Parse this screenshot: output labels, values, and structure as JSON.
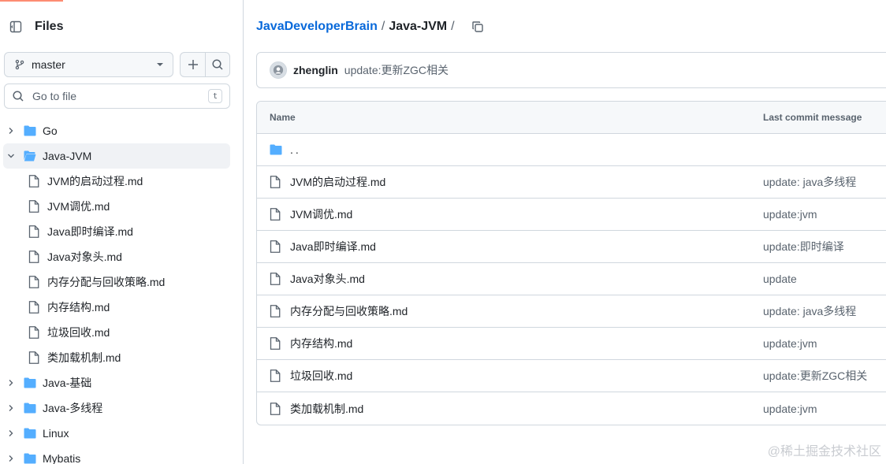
{
  "sidebar": {
    "title": "Files",
    "branch": "master",
    "search_placeholder": "Go to file",
    "search_shortcut": "t",
    "tree": [
      {
        "label": "Go",
        "type": "folder",
        "expanded": false
      },
      {
        "label": "Java-JVM",
        "type": "folder",
        "expanded": true
      },
      {
        "label": "JVM的启动过程.md",
        "type": "file"
      },
      {
        "label": "JVM调优.md",
        "type": "file"
      },
      {
        "label": "Java即时编译.md",
        "type": "file"
      },
      {
        "label": "Java对象头.md",
        "type": "file"
      },
      {
        "label": "内存分配与回收策略.md",
        "type": "file"
      },
      {
        "label": "内存结构.md",
        "type": "file"
      },
      {
        "label": "垃圾回收.md",
        "type": "file"
      },
      {
        "label": "类加载机制.md",
        "type": "file"
      },
      {
        "label": "Java-基础",
        "type": "folder",
        "expanded": false
      },
      {
        "label": "Java-多线程",
        "type": "folder",
        "expanded": false
      },
      {
        "label": "Linux",
        "type": "folder",
        "expanded": false
      },
      {
        "label": "Mybatis",
        "type": "folder",
        "expanded": false
      }
    ]
  },
  "breadcrumb": {
    "repo": "JavaDeveloperBrain",
    "sep1": "/",
    "dir": "Java-JVM",
    "sep2": "/"
  },
  "commit": {
    "author": "zhenglin",
    "message": "update:更新ZGC相关"
  },
  "table": {
    "col_name": "Name",
    "col_commit": "Last commit message",
    "parent": "..",
    "rows": [
      {
        "name": "JVM的启动过程.md",
        "commit": "update: java多线程"
      },
      {
        "name": "JVM调优.md",
        "commit": "update:jvm"
      },
      {
        "name": "Java即时编译.md",
        "commit": "update:即时编译"
      },
      {
        "name": "Java对象头.md",
        "commit": "update"
      },
      {
        "name": "内存分配与回收策略.md",
        "commit": "update: java多线程"
      },
      {
        "name": "内存结构.md",
        "commit": "update:jvm"
      },
      {
        "name": "垃圾回收.md",
        "commit": "update:更新ZGC相关"
      },
      {
        "name": "类加载机制.md",
        "commit": "update:jvm"
      }
    ]
  },
  "watermark": "@稀土掘金技术社区",
  "colors": {
    "folder": "#54aeff",
    "link": "#0969da",
    "border": "#d0d7de",
    "muted": "#59636e"
  }
}
